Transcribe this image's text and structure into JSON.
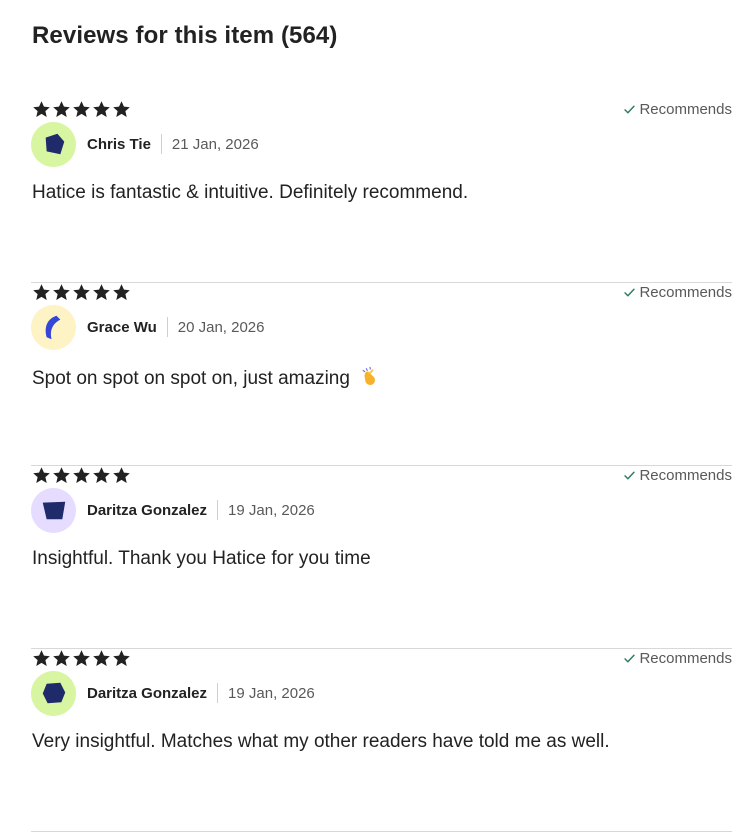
{
  "heading": "Reviews for this item (564)",
  "reviews": [
    {
      "rating": 5,
      "recommends_label": "Recommends",
      "name": "Chris Tie",
      "date": "21 Jan, 2026",
      "text": "Hatice is fantastic & intuitive. Definitely recommend.",
      "avatar": {
        "bg": "#d8f5a2",
        "shape_color": "#1f2a6b",
        "shape": "pentagon"
      }
    },
    {
      "rating": 5,
      "recommends_label": "Recommends",
      "name": "Grace Wu",
      "date": "20 Jan, 2026",
      "text": "Spot on spot on spot on, just amazing",
      "avatar": {
        "bg": "#fdf3c4",
        "shape_color": "#3446d8",
        "shape": "crescent"
      }
    },
    {
      "rating": 5,
      "recommends_label": "Recommends",
      "name": "Daritza Gonzalez",
      "date": "19 Jan, 2026",
      "text": "Insightful. Thank you Hatice for you time",
      "avatar": {
        "bg": "#e6dcff",
        "shape_color": "#1f2a6b",
        "shape": "trapezoid"
      }
    },
    {
      "rating": 5,
      "recommends_label": "Recommends",
      "name": "Daritza Gonzalez",
      "date": "19 Jan, 2026",
      "text": "Very insightful. Matches what my other readers have told me as well.",
      "avatar": {
        "bg": "#d8f5a2",
        "shape_color": "#1f2a6b",
        "shape": "hexagon"
      }
    }
  ],
  "icons": {
    "star": "star-icon",
    "check": "check-icon",
    "emoji": "clapping-hands-emoji"
  },
  "colors": {
    "star": "#222222",
    "check": "#2e7d5b",
    "divider": "#d8d8d8"
  }
}
